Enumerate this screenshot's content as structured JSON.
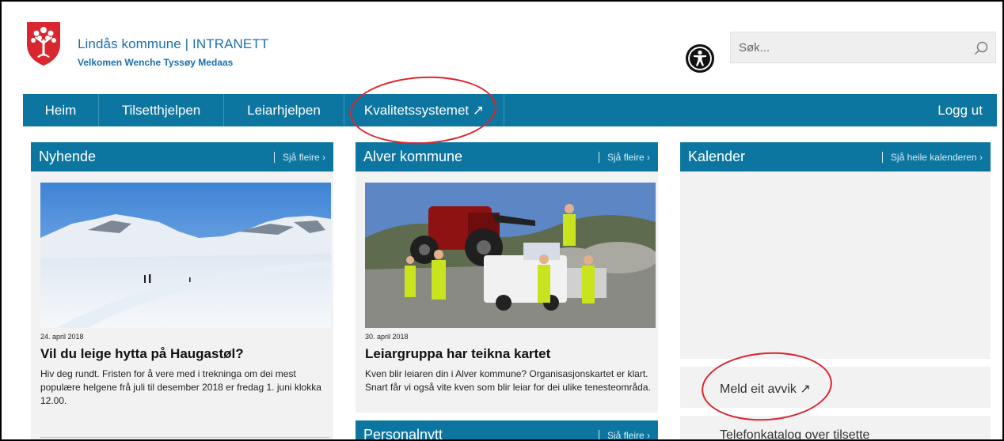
{
  "header": {
    "title": "Lindås kommune | INTRANETT",
    "welcome": "Velkomen Wenche Tyssøy Medaas",
    "search_placeholder": "Søk..."
  },
  "nav": {
    "items": [
      {
        "label": "Heim"
      },
      {
        "label": "Tilsetthjelpen"
      },
      {
        "label": "Leiarhjelpen"
      },
      {
        "label": "Kvalitetssystemet ↗"
      }
    ],
    "logout": "Logg ut"
  },
  "columns": {
    "news": {
      "title": "Nyhende",
      "more": "Sjå fleire ›",
      "date": "24. april 2018",
      "headline": "Vil du leige hytta på Haugastøl?",
      "body": "Hiv deg rundt. Fristen for å vere med i trekninga om dei mest populære helgene frå juli til desember 2018 er fredag 1. juni klokka 12.00."
    },
    "alver": {
      "title": "Alver kommune",
      "more": "Sjå fleire ›",
      "date": "30. april 2018",
      "headline": "Leiargruppa har teikna kartet",
      "body": "Kven blir leiaren din i Alver kommune? Organisasjonskartet er klart. Snart får vi også vite kven som blir leiar for dei ulike tenesteområda."
    },
    "personal": {
      "title": "Personalnytt",
      "more": "Sjå fleire ›"
    },
    "calendar": {
      "title": "Kalender",
      "more": "Sjå heile kalenderen ›"
    }
  },
  "side_links": {
    "report": "Meld eit avvik ↗",
    "phonebook": "Telefonkatalog over tilsette"
  },
  "colors": {
    "brand_blue": "#0d76a0",
    "link_blue": "#1b6fae",
    "annotation_red": "#d9262f"
  }
}
